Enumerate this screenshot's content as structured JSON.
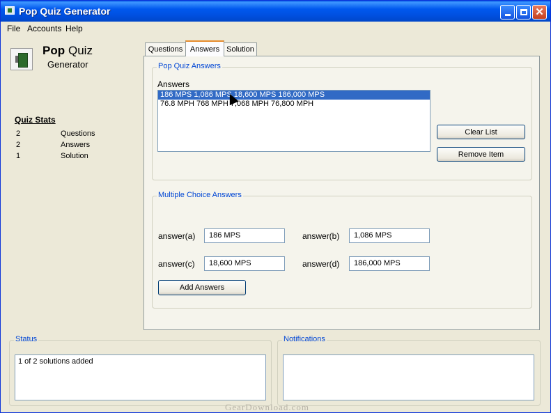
{
  "window": {
    "title": "Pop Quiz Generator"
  },
  "menu": [
    "File",
    "Accounts",
    "Help"
  ],
  "app": {
    "name_bold": "Pop",
    "name_regular": "Quiz",
    "subtitle": "Generator"
  },
  "stats": {
    "title": "Quiz Stats",
    "rows": [
      {
        "count": "2",
        "label": "Questions"
      },
      {
        "count": "2",
        "label": "Answers"
      },
      {
        "count": "1",
        "label": "Solution"
      }
    ]
  },
  "tabs": [
    {
      "label": "Questions",
      "active": false
    },
    {
      "label": "Answers",
      "active": true
    },
    {
      "label": "Solution",
      "active": false
    }
  ],
  "answers_group": {
    "legend": "Pop Quiz Answers",
    "list_label": "Answers",
    "items": [
      "186 MPS 1,086 MPS 18,600 MPS 186,000 MPS",
      "76.8 MPH 768 MPH 7,068 MPH 76,800 MPH"
    ],
    "selected_index": 0,
    "clear_label": "Clear List",
    "remove_label": "Remove Item"
  },
  "mc_group": {
    "legend": "Multiple Choice Answers",
    "fields": [
      {
        "label": "answer(a)",
        "value": "186 MPS"
      },
      {
        "label": "answer(b)",
        "value": "1,086 MPS"
      },
      {
        "label": "answer(c)",
        "value": "18,600 MPS"
      },
      {
        "label": "answer(d)",
        "value": "186,000 MPS"
      }
    ],
    "add_label": "Add Answers"
  },
  "status": {
    "legend": "Status",
    "text": "1 of 2 solutions added"
  },
  "notifications": {
    "legend": "Notifications",
    "text": ""
  },
  "watermark": "GearDownload.com"
}
